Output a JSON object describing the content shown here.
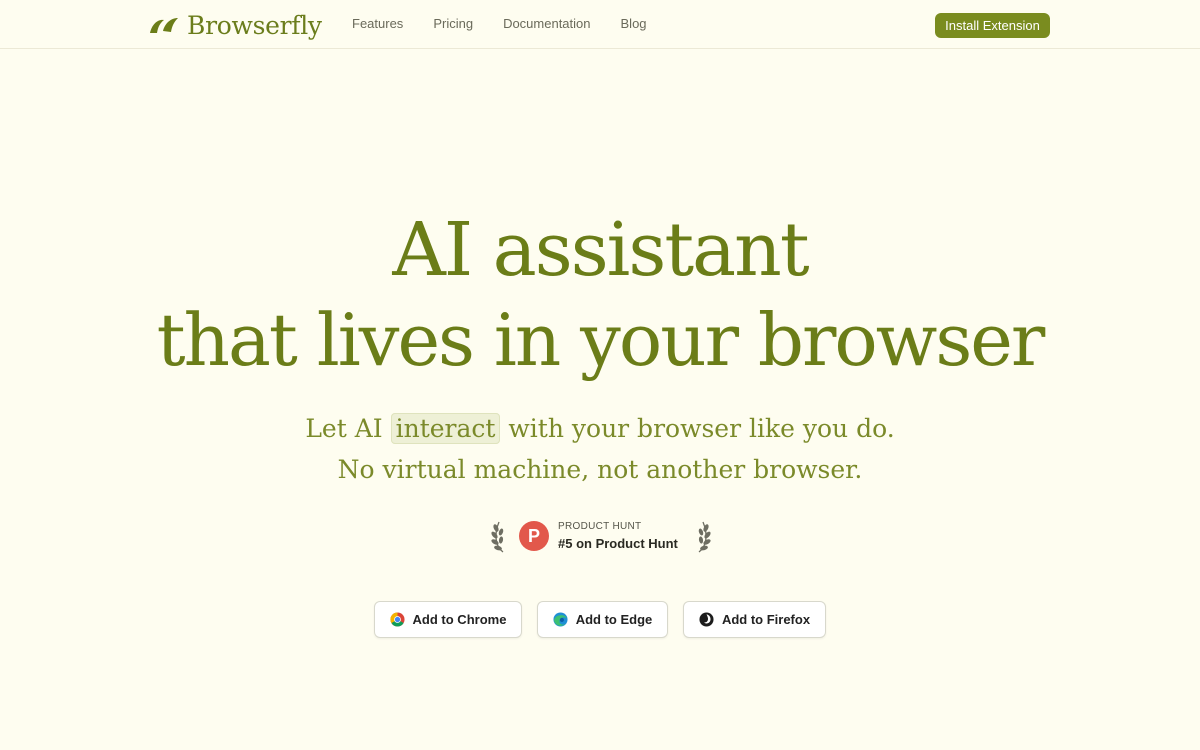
{
  "header": {
    "brand": "Browserfly",
    "logo_icon": "browserfly-wing-logo",
    "nav": [
      "Features",
      "Pricing",
      "Documentation",
      "Blog"
    ],
    "install_label": "Install Extension"
  },
  "hero": {
    "title_line1": "AI assistant",
    "title_line2": "that lives in your browser",
    "subtitle_before": "Let AI ",
    "subtitle_highlight": "interact",
    "subtitle_after": " with your browser like you do.",
    "subtitle_line2": "No virtual machine, not another browser."
  },
  "product_hunt": {
    "logo_letter": "P",
    "label": "PRODUCT HUNT",
    "rank": "#5 on Product Hunt"
  },
  "buttons": {
    "chrome": "Add to Chrome",
    "edge": "Add to Edge",
    "firefox": "Add to Firefox"
  },
  "colors": {
    "background": "#fefdf0",
    "brand_green": "#6b7d18",
    "accent_button": "#7a8c1f",
    "product_hunt": "#e2584b"
  }
}
